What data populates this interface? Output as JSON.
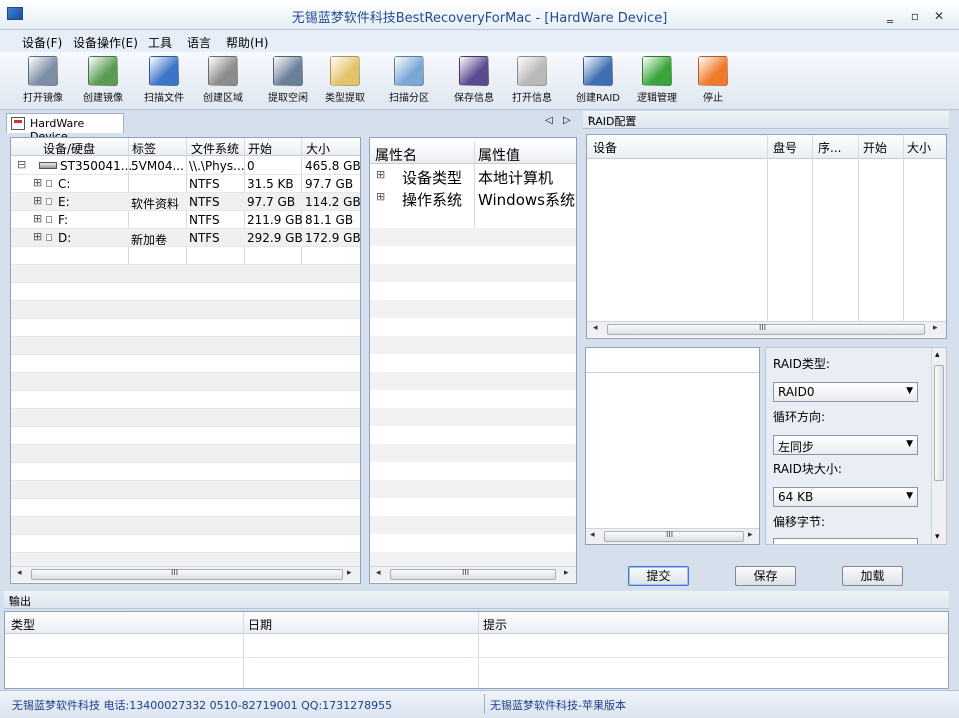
{
  "window": {
    "title": "无锡蓝梦软件科技BestRecoveryForMac - [HardWare Device]",
    "minimize": "‗",
    "restore": "▫",
    "close": "✕"
  },
  "menu": [
    "设备(F)",
    "设备操作(E)",
    "工具",
    "语言",
    "帮助(H)"
  ],
  "toolbar": [
    {
      "label": "打开镜像",
      "icon": "open-image-icon",
      "color": "#7d8da5"
    },
    {
      "label": "创建镜像",
      "icon": "create-image-icon",
      "color": "#5a9c55"
    },
    {
      "label": "扫描文件",
      "icon": "scan-files-icon",
      "color": "#3b74c8"
    },
    {
      "label": "创建区域",
      "icon": "create-region-icon",
      "color": "#8c8c8c"
    },
    {
      "label": "提取空闲",
      "icon": "extract-free-icon",
      "color": "#6b7f99"
    },
    {
      "label": "类型提取",
      "icon": "type-extract-icon",
      "color": "#e3c36a"
    },
    {
      "label": "扫描分区",
      "icon": "scan-partition-icon",
      "color": "#7aa7d6"
    },
    {
      "label": "保存信息",
      "icon": "save-info-icon",
      "color": "#5a4b8f"
    },
    {
      "label": "打开信息",
      "icon": "open-info-icon",
      "color": "#b9b9b9"
    },
    {
      "label": "创建RAID",
      "icon": "create-raid-icon",
      "color": "#3f6fb3"
    },
    {
      "label": "逻辑管理",
      "icon": "logic-manage-icon",
      "color": "#3aa53a"
    },
    {
      "label": "停止",
      "icon": "stop-icon",
      "color": "#f07a2a"
    }
  ],
  "device_tab": {
    "label": "HardWare Device"
  },
  "device_table": {
    "headers": [
      "设备/硬盘",
      "标签",
      "文件系统",
      "开始",
      "大小"
    ],
    "rows": [
      {
        "name": "ST350041...",
        "label": "5VM04...",
        "fs": "\\\\.\\Phys...",
        "start": "0",
        "size": "465.8 GB",
        "expander": "⊟"
      },
      {
        "name": "C:",
        "label": "",
        "fs": "NTFS",
        "start": "31.5 KB",
        "size": "97.7 GB",
        "expander": "⊞"
      },
      {
        "name": "E:",
        "label": "软件资料",
        "fs": "NTFS",
        "start": "97.7 GB",
        "size": "114.2 GB",
        "expander": "⊞"
      },
      {
        "name": "F:",
        "label": "",
        "fs": "NTFS",
        "start": "211.9 GB",
        "size": "81.1 GB",
        "expander": "⊞"
      },
      {
        "name": "D:",
        "label": "新加卷",
        "fs": "NTFS",
        "start": "292.9 GB",
        "size": "172.9 GB",
        "expander": "⊞"
      }
    ]
  },
  "property_table": {
    "headers": [
      "属性名",
      "属性值"
    ],
    "rows": [
      {
        "name": "设备类型",
        "value": "本地计算机",
        "expander": "⊞"
      },
      {
        "name": "操作系统",
        "value": "Windows系统",
        "expander": "⊞"
      }
    ]
  },
  "raid_panel": {
    "title": "RAID配置",
    "pin": "ᵖ",
    "headers": [
      "设备",
      "盘号",
      "序...",
      "开始",
      "大小"
    ],
    "raid_type_label": "RAID类型:",
    "raid_type_value": "RAID0",
    "loop_direction_label": "循环方向:",
    "loop_direction_value": "左同步",
    "block_size_label": "RAID块大小:",
    "block_size_value": "64 KB",
    "offset_label": "偏移字节:",
    "submit": "提交",
    "save": "保存",
    "load": "加载"
  },
  "output_panel": {
    "title": "输出",
    "pin": "ᵖ",
    "headers": [
      "类型",
      "日期",
      "提示"
    ]
  },
  "statusbar": {
    "left": "无锡蓝梦软件科技 电话:13400027332 0510-82719001 QQ:1731278955",
    "right": "无锡蓝梦软件科技-苹果版本"
  },
  "scroll": {
    "left": "◂",
    "right": "▸",
    "up": "▴",
    "down": "▾",
    "grip": "III"
  },
  "tab_nav": {
    "prev": "◁",
    "next": "▷"
  },
  "combo_arrow": "▼"
}
